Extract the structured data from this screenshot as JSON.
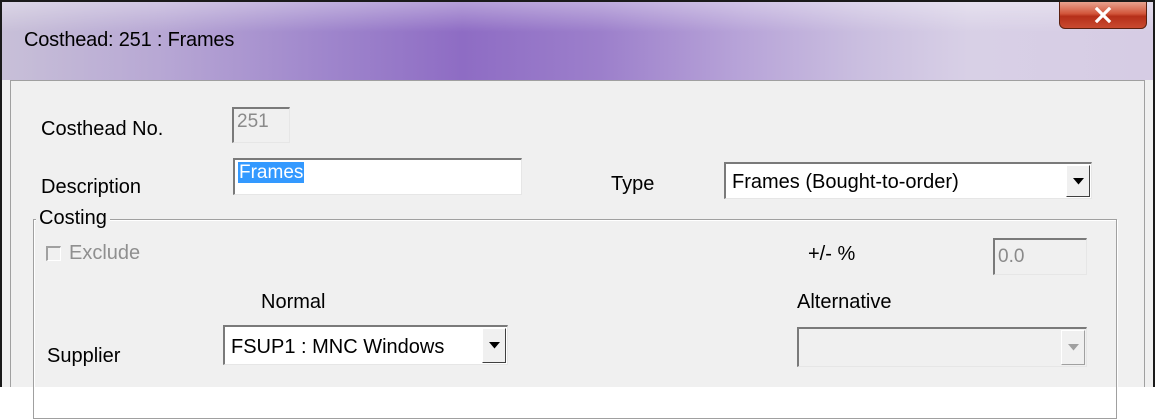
{
  "window": {
    "title": "Costhead: 251 : Frames",
    "close_icon": "close-x-icon"
  },
  "form": {
    "costhead_no_label": "Costhead No.",
    "costhead_no_value": "251",
    "description_label": "Description",
    "description_value": "Frames",
    "type_label": "Type",
    "type_value": "Frames (Bought-to-order)"
  },
  "costing": {
    "group_label": "Costing",
    "exclude_label": "Exclude",
    "exclude_checked": false,
    "plus_minus_label": "+/- %",
    "plus_minus_value": "0.0",
    "normal_header": "Normal",
    "alternative_header": "Alternative",
    "supplier_label": "Supplier",
    "supplier_normal_value": "FSUP1 : MNC Windows",
    "supplier_alternative_value": ""
  },
  "colors": {
    "selection": "#3399ff",
    "close_button": "#c94a30",
    "titlebar_accent": "#8e6cc4"
  }
}
